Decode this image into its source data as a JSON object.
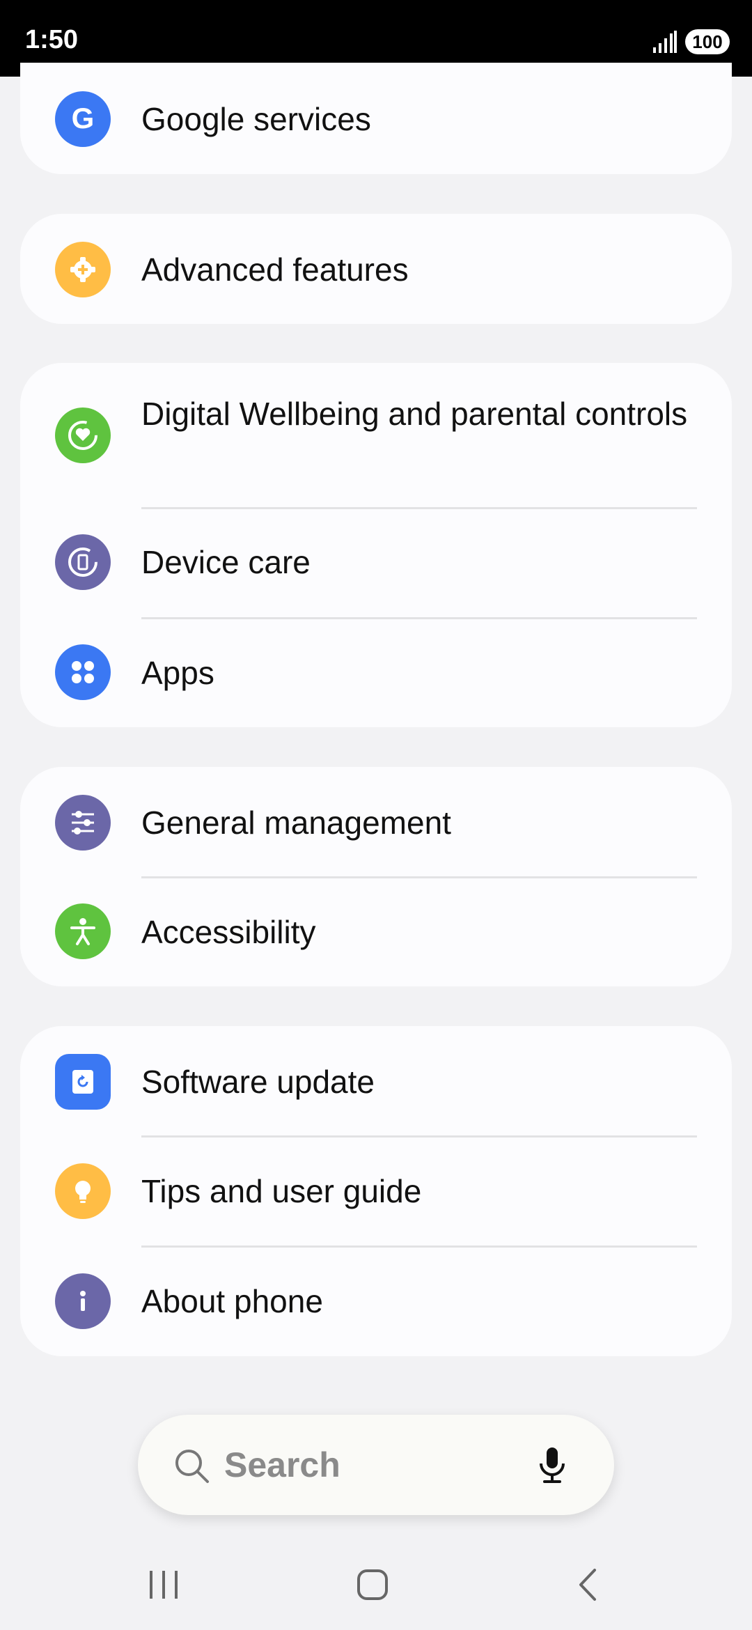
{
  "status": {
    "time": "1:50",
    "battery": "100"
  },
  "settings": {
    "google_services": "Google services",
    "advanced_features": "Advanced features",
    "digital_wellbeing": "Digital Wellbeing and parental controls",
    "device_care": "Device care",
    "apps": "Apps",
    "general_management": "General management",
    "accessibility": "Accessibility",
    "software_update": "Software update",
    "tips": "Tips and user guide",
    "about_phone": "About phone"
  },
  "search": {
    "placeholder": "Search"
  },
  "colors": {
    "google": "#3b78f3",
    "advanced": "#ffbd45",
    "wellbeing": "#5fc33f",
    "device_care": "#6b67a8",
    "apps": "#3b78f3",
    "general": "#6b67a8",
    "accessibility": "#5fc33f",
    "software": "#3b78f3",
    "tips": "#ffbd45",
    "about": "#6b67a8"
  },
  "icons": {
    "google": "google-g-icon",
    "advanced": "gear-plus-icon",
    "wellbeing": "heart-circle-icon",
    "device_care": "device-care-icon",
    "apps": "apps-grid-icon",
    "general": "sliders-icon",
    "accessibility": "accessibility-person-icon",
    "software": "software-update-icon",
    "tips": "lightbulb-icon",
    "about": "info-icon",
    "search": "search-icon",
    "mic": "microphone-icon"
  }
}
